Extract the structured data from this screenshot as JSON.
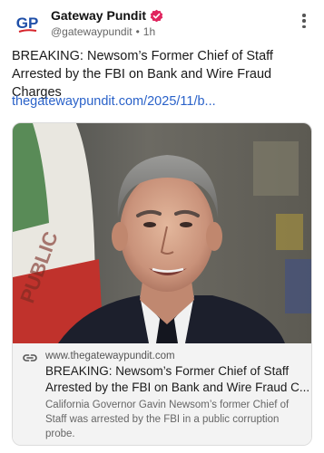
{
  "post": {
    "author": {
      "name": "Gateway Pundit",
      "handle": "@gatewaypundit",
      "time": "1h",
      "avatar_text": "GP",
      "avatar_icon": "gp-logo-icon",
      "verified_icon": "verified-badge-icon"
    },
    "more_icon": "vertical-ellipsis-icon",
    "text": "BREAKING: Newsom’s Former Chief of Staff Arrested by the FBI on Bank and Wire Fraud Charges",
    "link": "thegatewaypundit.com/2025/11/b...",
    "card": {
      "image_icon": "news-photo-man-in-suit",
      "link_icon": "link-icon",
      "domain": "www.thegatewaypundit.com",
      "title_line1": "BREAKING: Newsom’s Former Chief of Staff",
      "title_line2": "Arrested by the FBI on Bank and Wire Fraud C...",
      "description": "California Governor Gavin Newsom’s former Chief of Staff was arrested by the FBI in a public corruption probe."
    }
  },
  "colors": {
    "link": "#2a62c9",
    "verified": "#e0245e",
    "brand_blue": "#1f4fa8",
    "brand_red": "#d6232a"
  }
}
